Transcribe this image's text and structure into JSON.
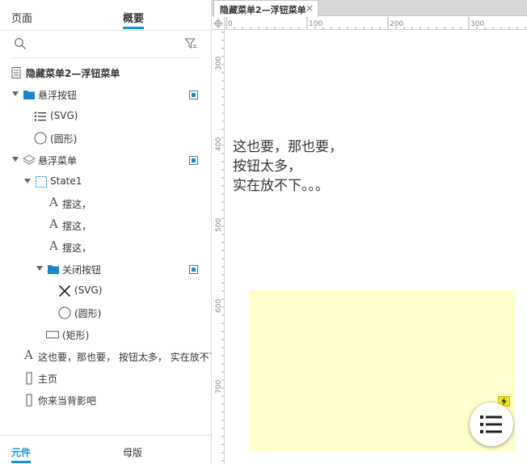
{
  "left_panel": {
    "tabs": [
      {
        "label": "页面",
        "active": false
      },
      {
        "label": "概要",
        "active": true
      }
    ],
    "outline": [
      {
        "label": "隐藏菜单2—浮钮菜单",
        "icon": "page-icon",
        "bold": true,
        "visible_toggle": false
      },
      {
        "label": "悬浮按钮",
        "icon": "folder-icon",
        "expandable": true,
        "visible_toggle": true
      },
      {
        "label": "(SVG)",
        "icon": "list-icon"
      },
      {
        "label": "(圆形)",
        "icon": "circle-icon"
      },
      {
        "label": "悬浮菜单",
        "icon": "layers-icon",
        "expandable": true,
        "visible_toggle": true
      },
      {
        "label": "State1",
        "icon": "state-icon",
        "expandable": true
      },
      {
        "label": "摆这，",
        "icon": "text-icon"
      },
      {
        "label": "摆这，",
        "icon": "text-icon"
      },
      {
        "label": "摆这，",
        "icon": "text-icon"
      },
      {
        "label": "关闭按钮",
        "icon": "folder-icon",
        "expandable": true,
        "visible_toggle": true
      },
      {
        "label": "(SVG)",
        "icon": "x-icon"
      },
      {
        "label": "(圆形)",
        "icon": "circle-icon"
      },
      {
        "label": "(矩形)",
        "icon": "rectangle-icon"
      },
      {
        "label": "这也要，那也要， 按钮太多， 实在放不下",
        "icon": "text-icon"
      },
      {
        "label": "主页",
        "icon": "hotspot-icon"
      },
      {
        "label": "你来当背影吧",
        "icon": "hotspot-icon"
      }
    ],
    "bottom_tabs": [
      {
        "label": "元件",
        "active": true
      },
      {
        "label": "母版",
        "active": false
      }
    ]
  },
  "editor": {
    "tab_label": "隐藏菜单2—浮钮菜单",
    "close_glyph": "×",
    "ruler_h": [
      "0",
      "100",
      "200",
      "300"
    ],
    "ruler_v": [
      "300",
      "400",
      "500",
      "600",
      "700"
    ],
    "canvas_text": "这也要，那也要，\n按钮太多，\n实在放不下。。。"
  },
  "colors": {
    "accent": "#1296db",
    "panel_yellow": "#ffffcc",
    "badge_yellow": "#f5e020"
  }
}
